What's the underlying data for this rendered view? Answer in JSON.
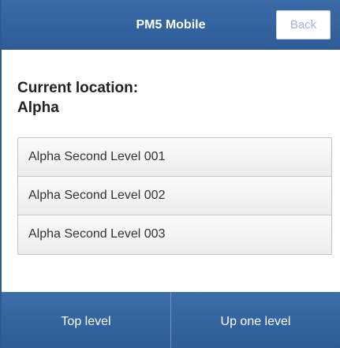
{
  "header": {
    "title": "PM5 Mobile",
    "back_label": "Back"
  },
  "location": {
    "label": "Current location:",
    "name": "Alpha"
  },
  "levels": [
    {
      "label": "Alpha Second Level 001"
    },
    {
      "label": "Alpha Second Level 002"
    },
    {
      "label": "Alpha Second Level 003"
    }
  ],
  "footer": {
    "top_level_label": "Top level",
    "up_one_level_label": "Up one level"
  },
  "colors": {
    "header_blue": "#3a6ba8",
    "footer_blue": "#2d5c97",
    "back_text": "#9fb7d6"
  }
}
